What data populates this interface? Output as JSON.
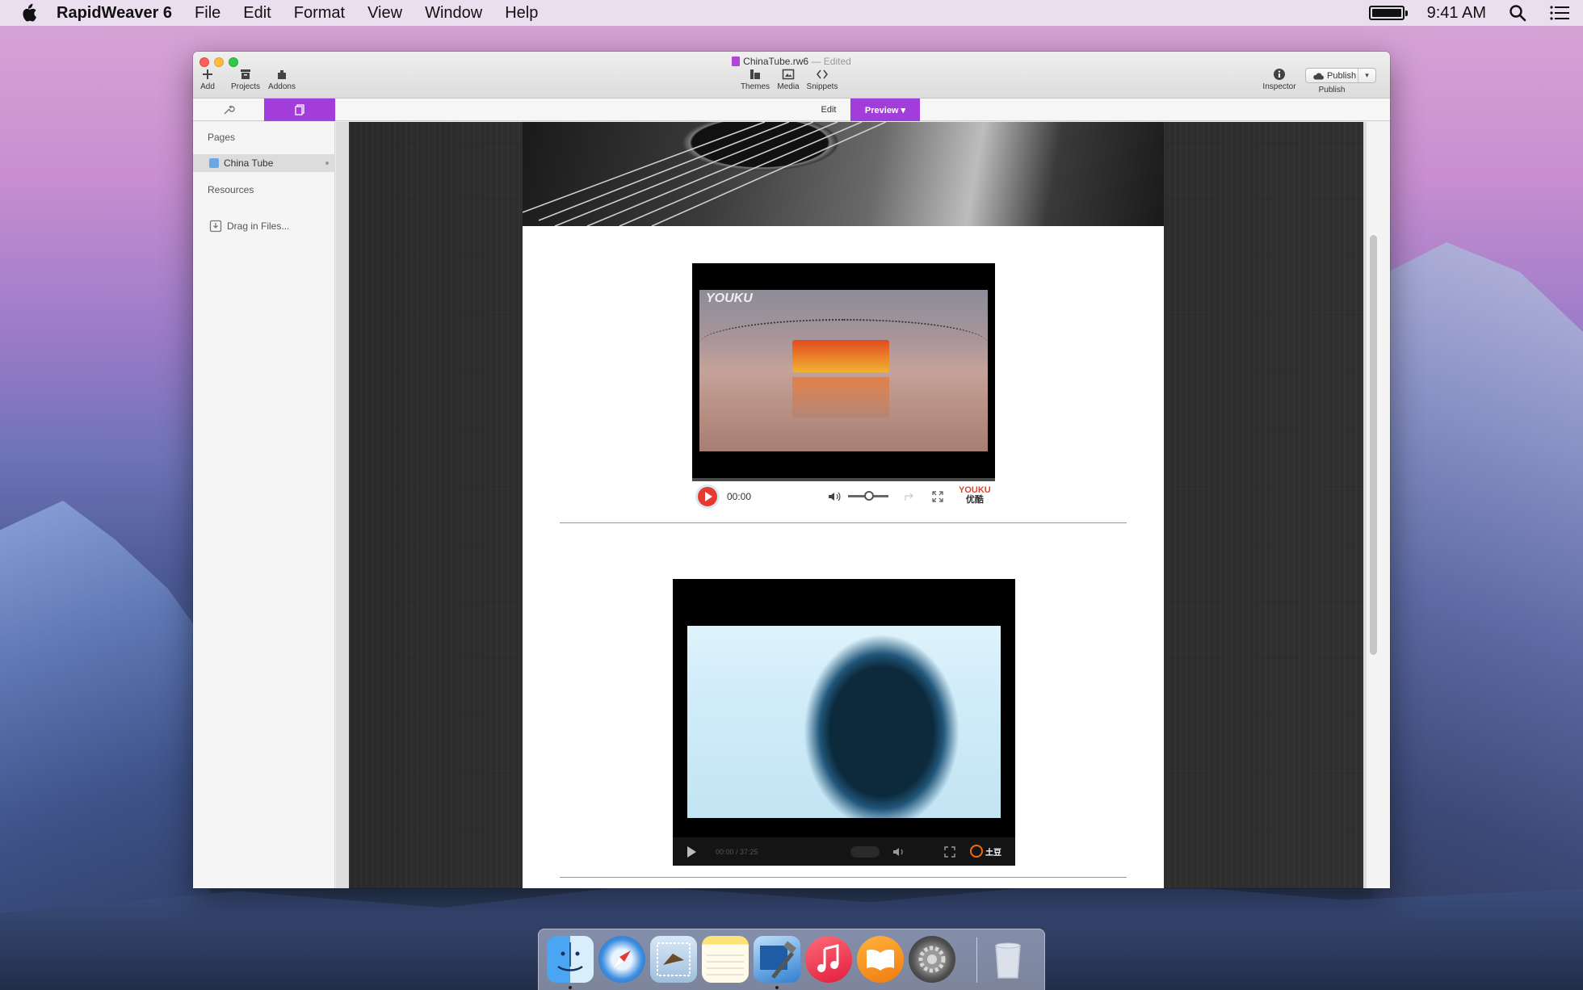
{
  "menubar": {
    "app_name": "RapidWeaver 6",
    "menus": [
      "File",
      "Edit",
      "Format",
      "View",
      "Window",
      "Help"
    ],
    "clock": "9:41 AM",
    "battery_level": 1.0
  },
  "window": {
    "doc_name": "ChinaTube.rw6",
    "doc_status": "— Edited",
    "toolbar": {
      "add": "Add",
      "projects": "Projects",
      "addons": "Addons",
      "themes": "Themes",
      "media": "Media",
      "snippets": "Snippets",
      "inspector": "Inspector",
      "publish_button": "Publish",
      "publish_label": "Publish"
    },
    "modes": {
      "edit": "Edit",
      "preview": "Preview ▾"
    },
    "sidebar": {
      "pages_heading": "Pages",
      "pages": [
        {
          "label": "China Tube"
        }
      ],
      "resources_heading": "Resources",
      "drag_in_files": "Drag in Files..."
    }
  },
  "preview": {
    "video1": {
      "watermark": "YOUKU",
      "time": "00:00",
      "brand_top": "YOUKU",
      "brand_bottom": "优酷",
      "progress": 0.0
    },
    "video2": {
      "time": "00:00 / 37:25",
      "brand": "土豆"
    }
  },
  "dock": {
    "apps": [
      "finder",
      "safari",
      "mail",
      "notes",
      "xcode",
      "itunes",
      "ibooks",
      "system-preferences",
      "trash"
    ]
  },
  "colors": {
    "accent_purple": "#a23ddc",
    "youku_red": "#e63a2e",
    "tudou_orange": "#f26c0d"
  }
}
